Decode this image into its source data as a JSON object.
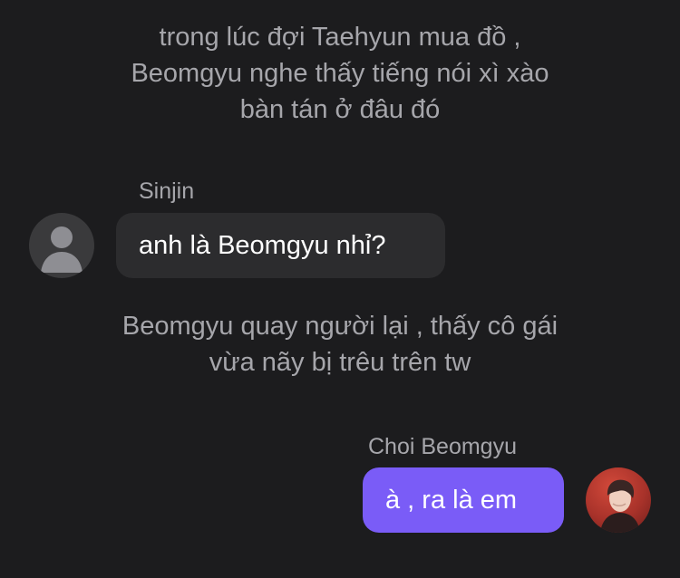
{
  "chat": {
    "narration_1": "trong lúc đợi Taehyun mua đồ ,\nBeomgyu nghe thấy tiếng nói xì xào\nbàn tán ở đâu đó",
    "messages": [
      {
        "sender": "Sinjin",
        "text": "anh là Beomgyu nhỉ?",
        "side": "left",
        "avatar": "default-person-icon"
      },
      {
        "sender": "Choi Beomgyu",
        "text": "à , ra là em",
        "side": "right",
        "avatar": "profile-photo"
      }
    ],
    "narration_2": "Beomgyu quay người lại , thấy cô gái\nvừa nãy bị trêu trên tw"
  },
  "colors": {
    "background": "#1c1c1e",
    "narration_text": "#a6a6ab",
    "incoming_bubble": "#2c2c2e",
    "outgoing_bubble": "#7a5cf7",
    "bubble_text": "#ffffff"
  }
}
